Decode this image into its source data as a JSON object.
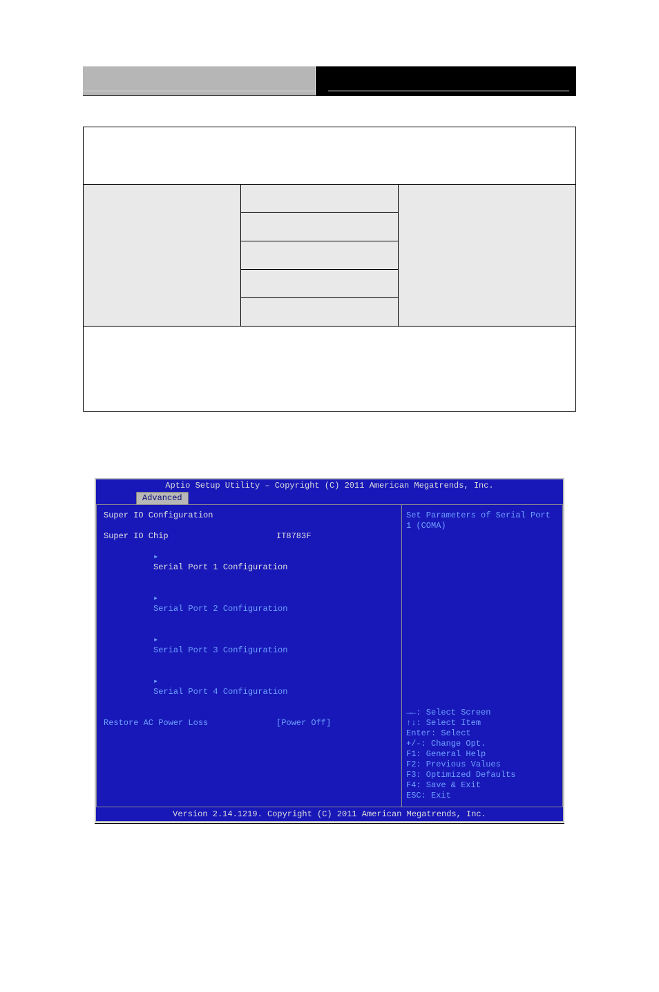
{
  "bios": {
    "titlebar": "Aptio Setup Utility – Copyright (C) 2011 American Megatrends, Inc.",
    "tab": "Advanced",
    "section_header": "Super IO Configuration",
    "chip": {
      "label": "Super IO Chip",
      "value": "IT8783F"
    },
    "menu_items": [
      "Serial Port 1 Configuration",
      "Serial Port 2 Configuration",
      "Serial Port 3 Configuration",
      "Serial Port 4 Configuration"
    ],
    "restore": {
      "label": "Restore AC Power Loss",
      "value": "[Power Off]"
    },
    "help_text": "Set Parameters of Serial Port 1 (COMA)",
    "key_help": [
      "→←: Select Screen",
      "↑↓: Select Item",
      "Enter: Select",
      "+/-: Change Opt.",
      "F1: General Help",
      "F2: Previous Values",
      "F3: Optimized Defaults",
      "F4: Save & Exit",
      "ESC: Exit"
    ],
    "footer": "Version 2.14.1219. Copyright (C) 2011 American Megatrends, Inc."
  }
}
